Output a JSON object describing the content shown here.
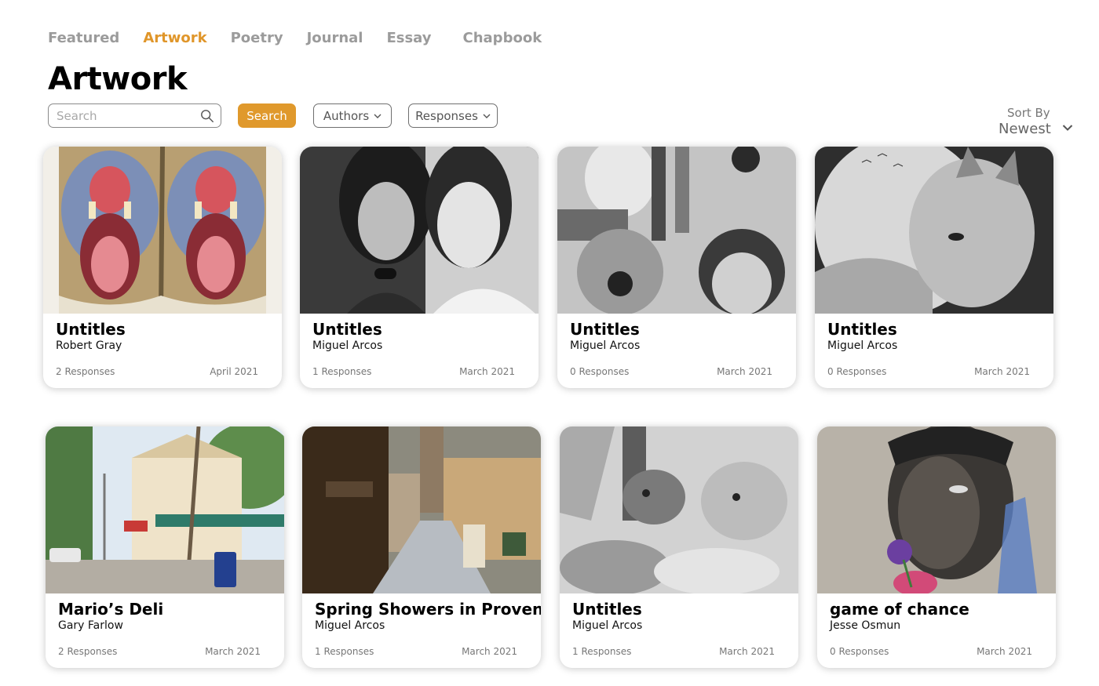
{
  "nav": {
    "tabs": [
      {
        "label": "Featured",
        "active": false
      },
      {
        "label": "Artwork",
        "active": true
      },
      {
        "label": "Poetry",
        "active": false
      },
      {
        "label": "Journal",
        "active": false
      },
      {
        "label": "Essay",
        "active": false
      },
      {
        "label": "Chapbook",
        "active": false
      }
    ]
  },
  "page": {
    "title": "Artwork"
  },
  "toolbar": {
    "search_placeholder": "Search",
    "search_button": "Search",
    "authors_label": "Authors",
    "responses_label": "Responses",
    "sort_label": "Sort By",
    "sort_value": "Newest"
  },
  "colors": {
    "accent": "#e0992c",
    "muted": "#9b9b9b"
  },
  "cards": [
    {
      "title": "Untitles",
      "author": "Robert Gray",
      "responses": "2 Responses",
      "date": "April 2021",
      "image": "baboon-mirror-drawing"
    },
    {
      "title": "Untitles",
      "author": "Miguel Arcos",
      "responses": "1 Responses",
      "date": "March 2021",
      "image": "two-women-portrait-drawing"
    },
    {
      "title": "Untitles",
      "author": "Miguel Arcos",
      "responses": "0 Responses",
      "date": "March 2021",
      "image": "faces-collage-drawing"
    },
    {
      "title": "Untitles",
      "author": "Miguel Arcos",
      "responses": "0 Responses",
      "date": "March 2021",
      "image": "lynx-drawing"
    },
    {
      "title": "Mario’s Deli",
      "author": "Gary Farlow",
      "responses": "2 Responses",
      "date": "March 2021",
      "image": "deli-street-painting"
    },
    {
      "title": "Spring Showers in Provence",
      "author": "Miguel Arcos",
      "responses": "1 Responses",
      "date": "March 2021",
      "image": "provence-street-painting"
    },
    {
      "title": "Untitles",
      "author": "Miguel Arcos",
      "responses": "1 Responses",
      "date": "March 2021",
      "image": "deer-wildlife-drawing"
    },
    {
      "title": "game of chance",
      "author": "Jesse Osmun",
      "responses": "0 Responses",
      "date": "March 2021",
      "image": "portrait-pastel-drawing"
    }
  ]
}
